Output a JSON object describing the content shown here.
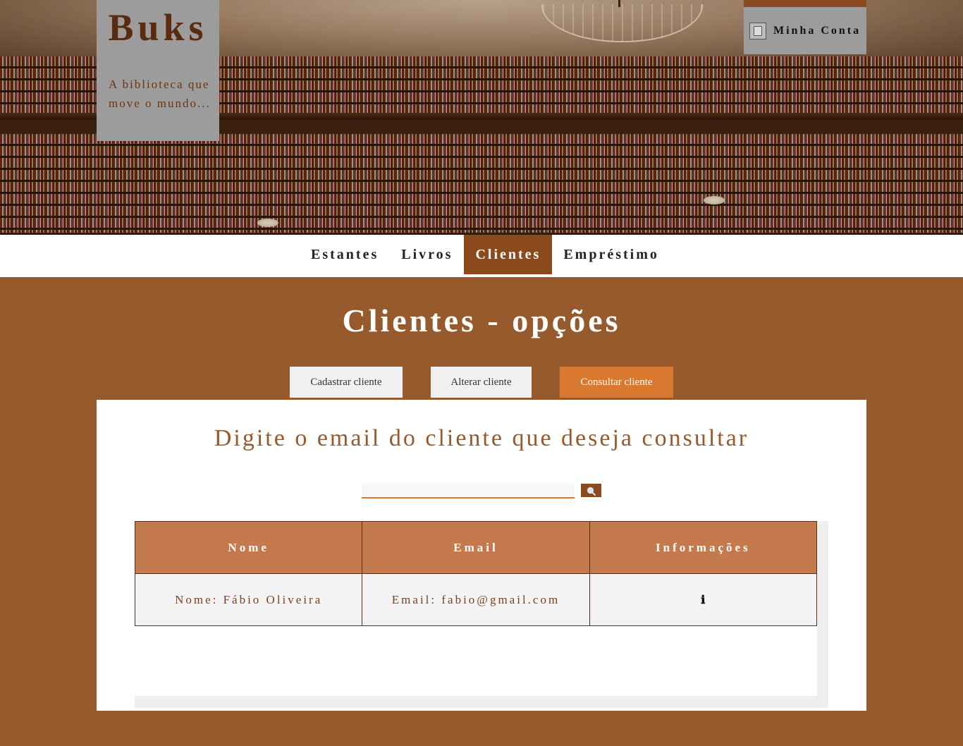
{
  "header": {
    "brand": "Buks",
    "tagline": "A biblioteca que move o mundo...",
    "account_label": "Minha Conta",
    "account_icon": "account-document-icon"
  },
  "nav": {
    "items": [
      {
        "label": "Estantes",
        "active": false
      },
      {
        "label": "Livros",
        "active": false
      },
      {
        "label": "Clientes",
        "active": true
      },
      {
        "label": "Empréstimo",
        "active": false
      }
    ]
  },
  "main": {
    "title": "Clientes - opções",
    "tabs": [
      {
        "label": "Cadastrar cliente",
        "active": false
      },
      {
        "label": "Alterar cliente",
        "active": false
      },
      {
        "label": "Consultar cliente",
        "active": true
      }
    ],
    "panel": {
      "heading": "Digite o email do cliente que deseja consultar",
      "search": {
        "value": "",
        "placeholder": "",
        "button_icon": "magnifier-icon"
      },
      "table": {
        "columns": [
          "Nome",
          "Email",
          "Informações"
        ],
        "rows": [
          {
            "nome": "Nome: Fábio Oliveira",
            "email": "Email: fabio@gmail.com",
            "info": "ℹ"
          }
        ]
      }
    }
  },
  "colors": {
    "background": "#965a2c",
    "accent": "#d9782f",
    "nav_active": "#8a4a1e",
    "table_header": "#c57a4e"
  }
}
